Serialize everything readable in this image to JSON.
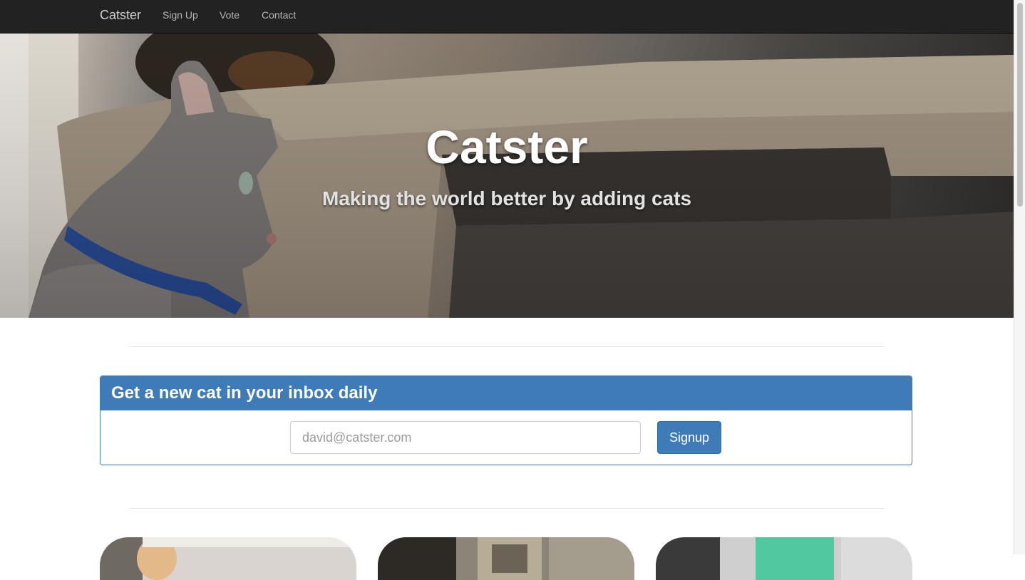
{
  "navbar": {
    "brand": "Catster",
    "links": [
      {
        "label": "Sign Up"
      },
      {
        "label": "Vote"
      },
      {
        "label": "Contact"
      }
    ]
  },
  "hero": {
    "title": "Catster",
    "subtitle": "Making the world better by adding cats",
    "image_icon": "cat-photo"
  },
  "newsletter": {
    "title": "Get a new cat in your inbox daily",
    "email_placeholder": "david@catster.com",
    "email_value": "",
    "button_label": "Signup"
  },
  "cat_cards": [
    {
      "image_icon": "cat-photo"
    },
    {
      "image_icon": "cat-photo"
    },
    {
      "image_icon": "cat-photo"
    }
  ],
  "colors": {
    "navbar_bg": "#222222",
    "primary": "#3f7bb6",
    "panel_border": "#3f7ab6"
  }
}
